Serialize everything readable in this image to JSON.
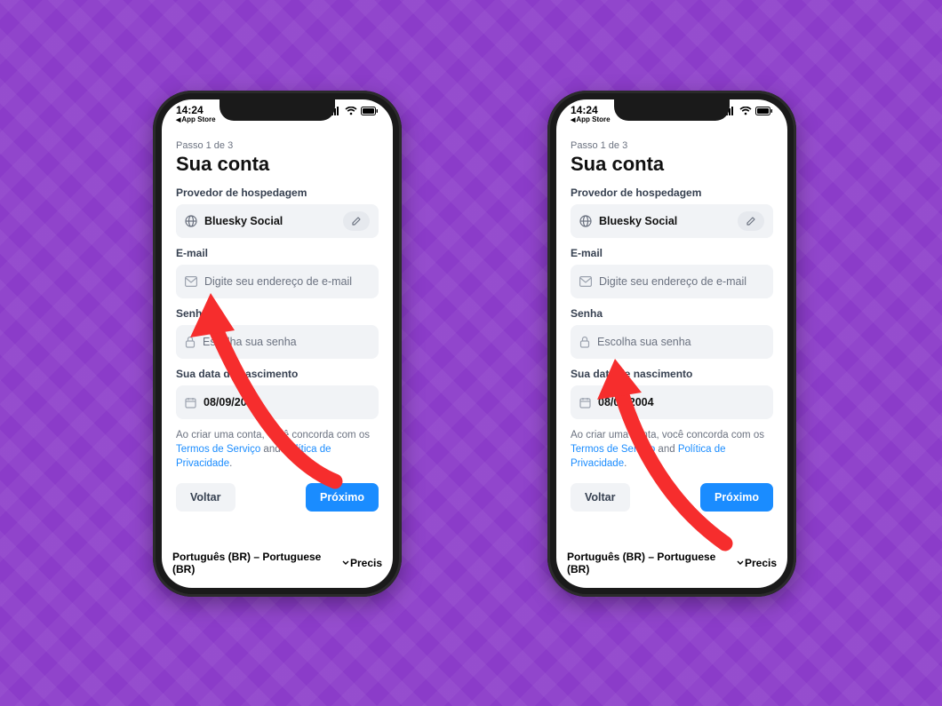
{
  "status": {
    "time": "14:24",
    "back_label": "App Store"
  },
  "step_label": "Passo 1 de 3",
  "title": "Sua conta",
  "labels": {
    "provider": "Provedor de hospedagem",
    "email": "E-mail",
    "password": "Senha",
    "birth": "Sua data de nascimento"
  },
  "fields": {
    "provider_value": "Bluesky Social",
    "email_placeholder": "Digite seu endereço de e-mail",
    "password_placeholder": "Escolha sua senha",
    "birth_value": "08/09/2004"
  },
  "terms": {
    "pre": "Ao criar uma conta, você concorda com os ",
    "tos": "Termos de Serviço",
    "mid": " and ",
    "privacy": "Política de Privacidade",
    "post": "."
  },
  "buttons": {
    "back": "Voltar",
    "next": "Próximo"
  },
  "bottom": {
    "language": "Português (BR) – Portuguese (BR)",
    "help": "Precis"
  },
  "colors": {
    "accent": "#1a8cff",
    "bg": "#8b3cc9",
    "arrow": "#f62d2d"
  }
}
